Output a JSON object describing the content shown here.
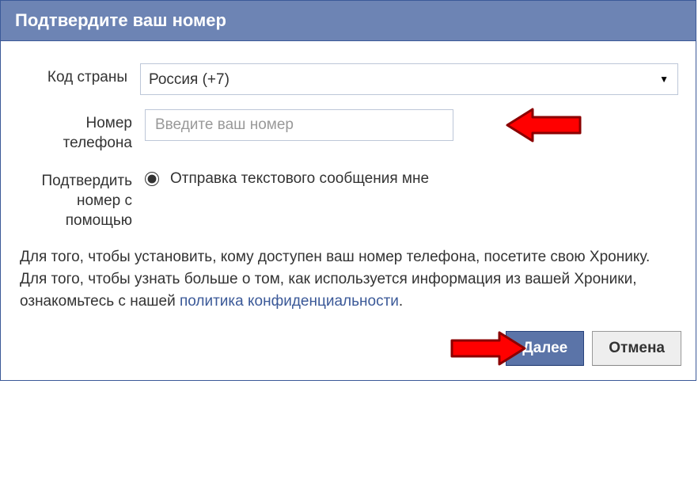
{
  "header": {
    "title": "Подтвердите ваш номер"
  },
  "form": {
    "country": {
      "label": "Код страны",
      "selected": "Россия (+7)"
    },
    "phone": {
      "label": "Номер телефона",
      "placeholder": "Введите ваш номер"
    },
    "confirm": {
      "label": "Подтвердить номер с помощью",
      "option": "Отправка текстового сообщения мне"
    }
  },
  "info": {
    "part1": "Для того, чтобы установить, кому доступен ваш номер телефона, посетите свою Хронику. Для того, чтобы узнать больше о том, как используется информация из вашей Хроники, ознакомьтесь с нашей ",
    "link": "политика конфиденциальности",
    "part2": "."
  },
  "footer": {
    "next": "Далее",
    "cancel": "Отмена"
  }
}
